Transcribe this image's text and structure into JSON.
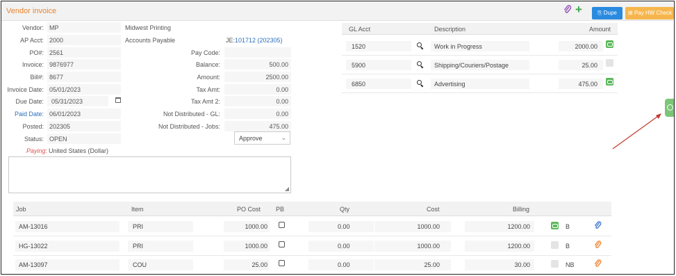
{
  "header": {
    "title": "Vendor invoice",
    "dupe_label": "Dupe",
    "pay_label": "Pay HW Check"
  },
  "left_fields": [
    {
      "label": "Vendor:",
      "value": "MP"
    },
    {
      "label": "AP Acct:",
      "value": "2000"
    },
    {
      "label": "PO#:",
      "value": "2561"
    },
    {
      "label": "Invoice:",
      "value": "9876977"
    },
    {
      "label": "Bill#:",
      "value": "8677"
    },
    {
      "label": "Invoice Date:",
      "value": "05/01/2023"
    },
    {
      "label": "Due Date:",
      "value": "05/31/2023"
    },
    {
      "label": "Paid Date:",
      "value": "06/01/2023"
    },
    {
      "label": "Posted:",
      "value": "202305"
    },
    {
      "label": "Status:",
      "value": "OPEN"
    }
  ],
  "vendor_name": "Midwest Printing",
  "ap_account_name": "Accounts Payable",
  "je_label": "JE:",
  "je_link": "101712 (202305)",
  "mid_fields": [
    {
      "label": "Pay Code:",
      "value": ""
    },
    {
      "label": "Balance:",
      "value": "500.00"
    },
    {
      "label": "Amount:",
      "value": "2500.00"
    },
    {
      "label": "Tax Amt:",
      "value": "0.00"
    },
    {
      "label": "Tax Amt 2:",
      "value": "0.00"
    },
    {
      "label": "Not Distributed - GL:",
      "value": "0.00"
    },
    {
      "label": "Not Distributed - Jobs:",
      "value": "475.00"
    }
  ],
  "paying_label": "Paying:",
  "paying_value": "United States (Dollar)",
  "approve_select": "Approve",
  "gl": {
    "headers": {
      "acct": "GL Acct",
      "desc": "Description",
      "amount": "Amount"
    },
    "rows": [
      {
        "acct": "1520",
        "desc": "Work in Progress",
        "amount": "2000.00",
        "comment": true
      },
      {
        "acct": "5900",
        "desc": "Shipping/Couriers/Postage",
        "amount": "25.00",
        "comment": false
      },
      {
        "acct": "6850",
        "desc": "Advertising",
        "amount": "475.00",
        "comment": true
      }
    ]
  },
  "jobs": {
    "headers": {
      "job": "Job",
      "item": "Item",
      "po_cost": "PO Cost",
      "pb": "PB",
      "qty": "Qty",
      "cost": "Cost",
      "billing": "Billing"
    },
    "rows": [
      {
        "job": "AM-13016",
        "item": "PRI",
        "po_cost": "1000.00",
        "qty": "0.00",
        "cost": "1000.00",
        "billing": "1200.00",
        "flag": "B",
        "comment": true,
        "clip": "#4a7fd6"
      },
      {
        "job": "HG-13022",
        "item": "PRI",
        "po_cost": "1000.00",
        "qty": "0.00",
        "cost": "1000.00",
        "billing": "1200.00",
        "flag": "B",
        "comment": false,
        "clip": "#f08a3c"
      },
      {
        "job": "AM-13097",
        "item": "COU",
        "po_cost": "25.00",
        "qty": "0.00",
        "cost": "25.00",
        "billing": "30.00",
        "flag": "NB",
        "comment": false,
        "clip": "#f08a3c"
      }
    ]
  },
  "colors": {
    "accent": "#e8842c",
    "link": "#2a6ebb",
    "dupe": "#2a8adf",
    "pay": "#f7b64d",
    "green": "#5cb85c"
  }
}
